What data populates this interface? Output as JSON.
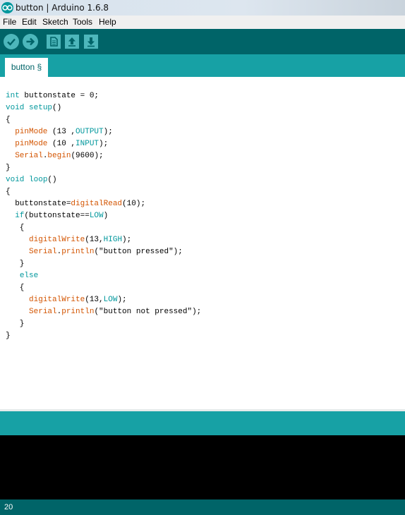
{
  "window": {
    "title": "button | Arduino 1.6.8"
  },
  "menu": [
    "File",
    "Edit",
    "Sketch",
    "Tools",
    "Help"
  ],
  "toolbar": {
    "buttons": [
      "verify-icon",
      "upload-icon",
      "new-icon",
      "open-icon",
      "save-icon"
    ]
  },
  "tabs": [
    {
      "label": "button §"
    }
  ],
  "code": [
    [
      {
        "t": "int",
        "c": "kw"
      },
      {
        "t": " buttonstate = 0;"
      }
    ],
    [
      {
        "t": "void",
        "c": "kw"
      },
      {
        "t": " "
      },
      {
        "t": "setup",
        "c": "kw"
      },
      {
        "t": "()"
      }
    ],
    [
      {
        "t": "{"
      }
    ],
    [
      {
        "t": "  "
      },
      {
        "t": "pinMode",
        "c": "fn"
      },
      {
        "t": " (13 ,"
      },
      {
        "t": "OUTPUT",
        "c": "const"
      },
      {
        "t": ");"
      }
    ],
    [
      {
        "t": "  "
      },
      {
        "t": "pinMode",
        "c": "fn"
      },
      {
        "t": " (10 ,"
      },
      {
        "t": "INPUT",
        "c": "const"
      },
      {
        "t": ");"
      }
    ],
    [
      {
        "t": "  "
      },
      {
        "t": "Serial",
        "c": "fn"
      },
      {
        "t": "."
      },
      {
        "t": "begin",
        "c": "fn"
      },
      {
        "t": "(9600);"
      }
    ],
    [
      {
        "t": "}"
      }
    ],
    [
      {
        "t": "void",
        "c": "kw"
      },
      {
        "t": " "
      },
      {
        "t": "loop",
        "c": "kw"
      },
      {
        "t": "()"
      }
    ],
    [
      {
        "t": "{"
      }
    ],
    [
      {
        "t": "  buttonstate="
      },
      {
        "t": "digitalRead",
        "c": "fn"
      },
      {
        "t": "(10);"
      }
    ],
    [
      {
        "t": "  "
      },
      {
        "t": "if",
        "c": "kw"
      },
      {
        "t": "(buttonstate=="
      },
      {
        "t": "LOW",
        "c": "const"
      },
      {
        "t": ")"
      }
    ],
    [
      {
        "t": "   {"
      }
    ],
    [
      {
        "t": "     "
      },
      {
        "t": "digitalWrite",
        "c": "fn"
      },
      {
        "t": "(13,"
      },
      {
        "t": "HIGH",
        "c": "const"
      },
      {
        "t": ");"
      }
    ],
    [
      {
        "t": "     "
      },
      {
        "t": "Serial",
        "c": "fn"
      },
      {
        "t": "."
      },
      {
        "t": "println",
        "c": "fn"
      },
      {
        "t": "(\"button pressed\");"
      }
    ],
    [
      {
        "t": "   }"
      }
    ],
    [
      {
        "t": "   "
      },
      {
        "t": "else",
        "c": "kw"
      }
    ],
    [
      {
        "t": "   {"
      }
    ],
    [
      {
        "t": "     "
      },
      {
        "t": "digitalWrite",
        "c": "fn"
      },
      {
        "t": "(13,"
      },
      {
        "t": "LOW",
        "c": "const"
      },
      {
        "t": ");"
      }
    ],
    [
      {
        "t": "     "
      },
      {
        "t": "Serial",
        "c": "fn"
      },
      {
        "t": "."
      },
      {
        "t": "println",
        "c": "fn"
      },
      {
        "t": "(\"button not pressed\");"
      }
    ],
    [
      {
        "t": "   }"
      }
    ],
    [
      {
        "t": "}"
      }
    ]
  ],
  "status": {
    "line_number": "20"
  },
  "colors": {
    "teal_dark": "#006468",
    "teal": "#17a1a5",
    "button": "#4db7bb",
    "keyword": "#00979c",
    "function": "#d35400"
  }
}
